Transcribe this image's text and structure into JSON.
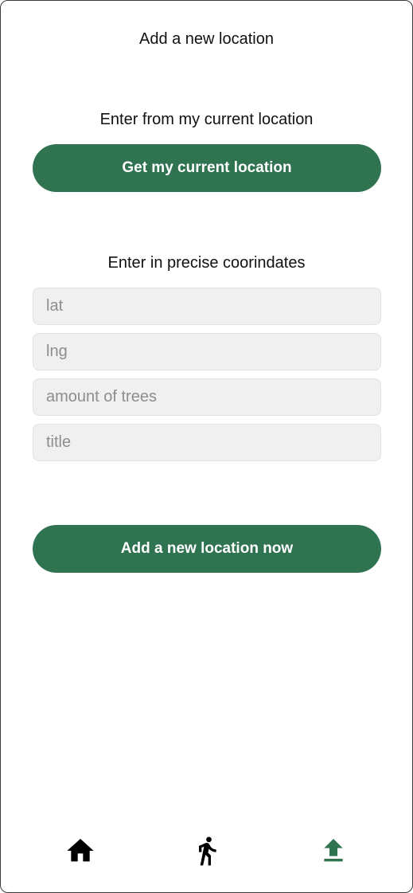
{
  "header": {
    "title": "Add a new location"
  },
  "current_location": {
    "label": "Enter from my current location",
    "button_label": "Get my current location"
  },
  "coordinates": {
    "label": "Enter in precise coorindates",
    "fields": [
      {
        "placeholder": "lat",
        "value": ""
      },
      {
        "placeholder": "lng",
        "value": ""
      },
      {
        "placeholder": "amount of trees",
        "value": ""
      },
      {
        "placeholder": "title",
        "value": ""
      }
    ]
  },
  "submit": {
    "button_label": "Add a new location now"
  },
  "bottom_nav": {
    "items": [
      {
        "icon": "home-icon",
        "active": false
      },
      {
        "icon": "walk-icon",
        "active": false
      },
      {
        "icon": "upload-icon",
        "active": true
      }
    ],
    "active_color": "#2f7350",
    "inactive_color": "#000000"
  },
  "colors": {
    "accent": "#2f7350",
    "field_background": "#f0f0f0"
  }
}
